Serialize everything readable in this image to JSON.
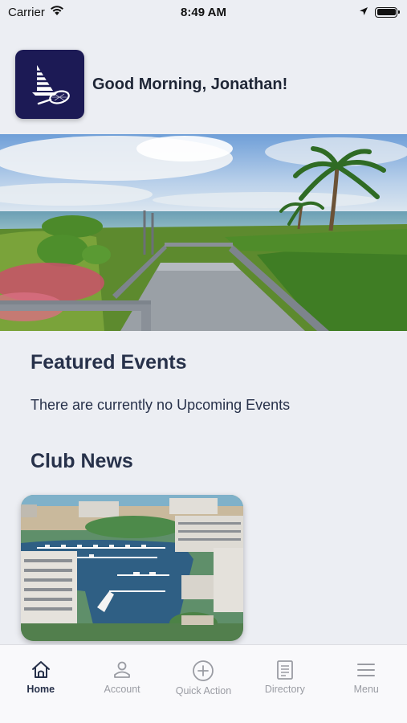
{
  "status_bar": {
    "carrier": "Carrier",
    "time": "8:49 AM"
  },
  "header": {
    "greeting": "Good Morning, Jonathan!"
  },
  "featured_events": {
    "title": "Featured Events",
    "empty_message": "There are currently no Upcoming Events"
  },
  "club_news": {
    "title": "Club News"
  },
  "tab_bar": {
    "tabs": [
      {
        "label": "Home",
        "icon": "home-icon",
        "active": true
      },
      {
        "label": "Account",
        "icon": "person-icon",
        "active": false
      },
      {
        "label": "Quick Action",
        "icon": "plus-circle-icon",
        "active": false
      },
      {
        "label": "Directory",
        "icon": "directory-icon",
        "active": false
      },
      {
        "label": "Menu",
        "icon": "menu-icon",
        "active": false
      }
    ]
  },
  "colors": {
    "background": "#eceef3",
    "logo_bg": "#1c1a55",
    "active_tab": "#27314a",
    "inactive_tab": "#9a9ca3"
  }
}
